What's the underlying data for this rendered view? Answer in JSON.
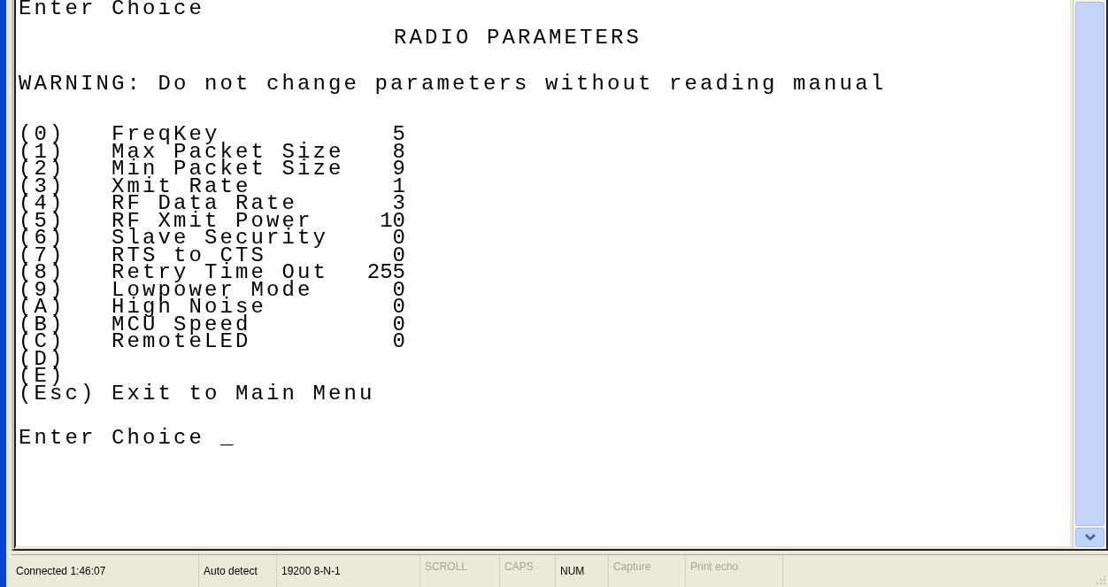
{
  "terminal": {
    "header_prompt": "Enter Choice",
    "title": "RADIO PARAMETERS",
    "warning": "WARNING: Do not change parameters without reading manual",
    "parameters": [
      {
        "key": "(0)",
        "name": "FreqKey",
        "value": "5"
      },
      {
        "key": "(1)",
        "name": "Max Packet Size",
        "value": "8"
      },
      {
        "key": "(2)",
        "name": "Min Packet Size",
        "value": "9"
      },
      {
        "key": "(3)",
        "name": "Xmit Rate",
        "value": "1"
      },
      {
        "key": "(4)",
        "name": "RF Data Rate",
        "value": "3"
      },
      {
        "key": "(5)",
        "name": "RF Xmit Power",
        "value": "10"
      },
      {
        "key": "(6)",
        "name": "Slave Security",
        "value": "0"
      },
      {
        "key": "(7)",
        "name": "RTS to CTS",
        "value": "0"
      },
      {
        "key": "(8)",
        "name": "Retry Time Out",
        "value": "255"
      },
      {
        "key": "(9)",
        "name": "Lowpower Mode",
        "value": "0"
      },
      {
        "key": "(A)",
        "name": "High Noise",
        "value": "0"
      },
      {
        "key": "(B)",
        "name": "MCU Speed",
        "value": "0"
      },
      {
        "key": "(C)",
        "name": "RemoteLED",
        "value": "0"
      },
      {
        "key": "(D)"
      },
      {
        "key": "(E)"
      }
    ],
    "exit_option": {
      "key": "(Esc)",
      "label": "Exit to Main Menu"
    },
    "prompt": "Enter Choice",
    "cursor": "_"
  },
  "status_bar": [
    {
      "text": "Connected 1:46:07",
      "disabled": false
    },
    {
      "text": "Auto detect",
      "disabled": false
    },
    {
      "text": "19200 8-N-1",
      "disabled": false
    },
    {
      "text": "SCROLL",
      "disabled": true
    },
    {
      "text": "CAPS",
      "disabled": true
    },
    {
      "text": "NUM",
      "disabled": false
    },
    {
      "text": "Capture",
      "disabled": true
    },
    {
      "text": "Print echo",
      "disabled": true
    }
  ]
}
